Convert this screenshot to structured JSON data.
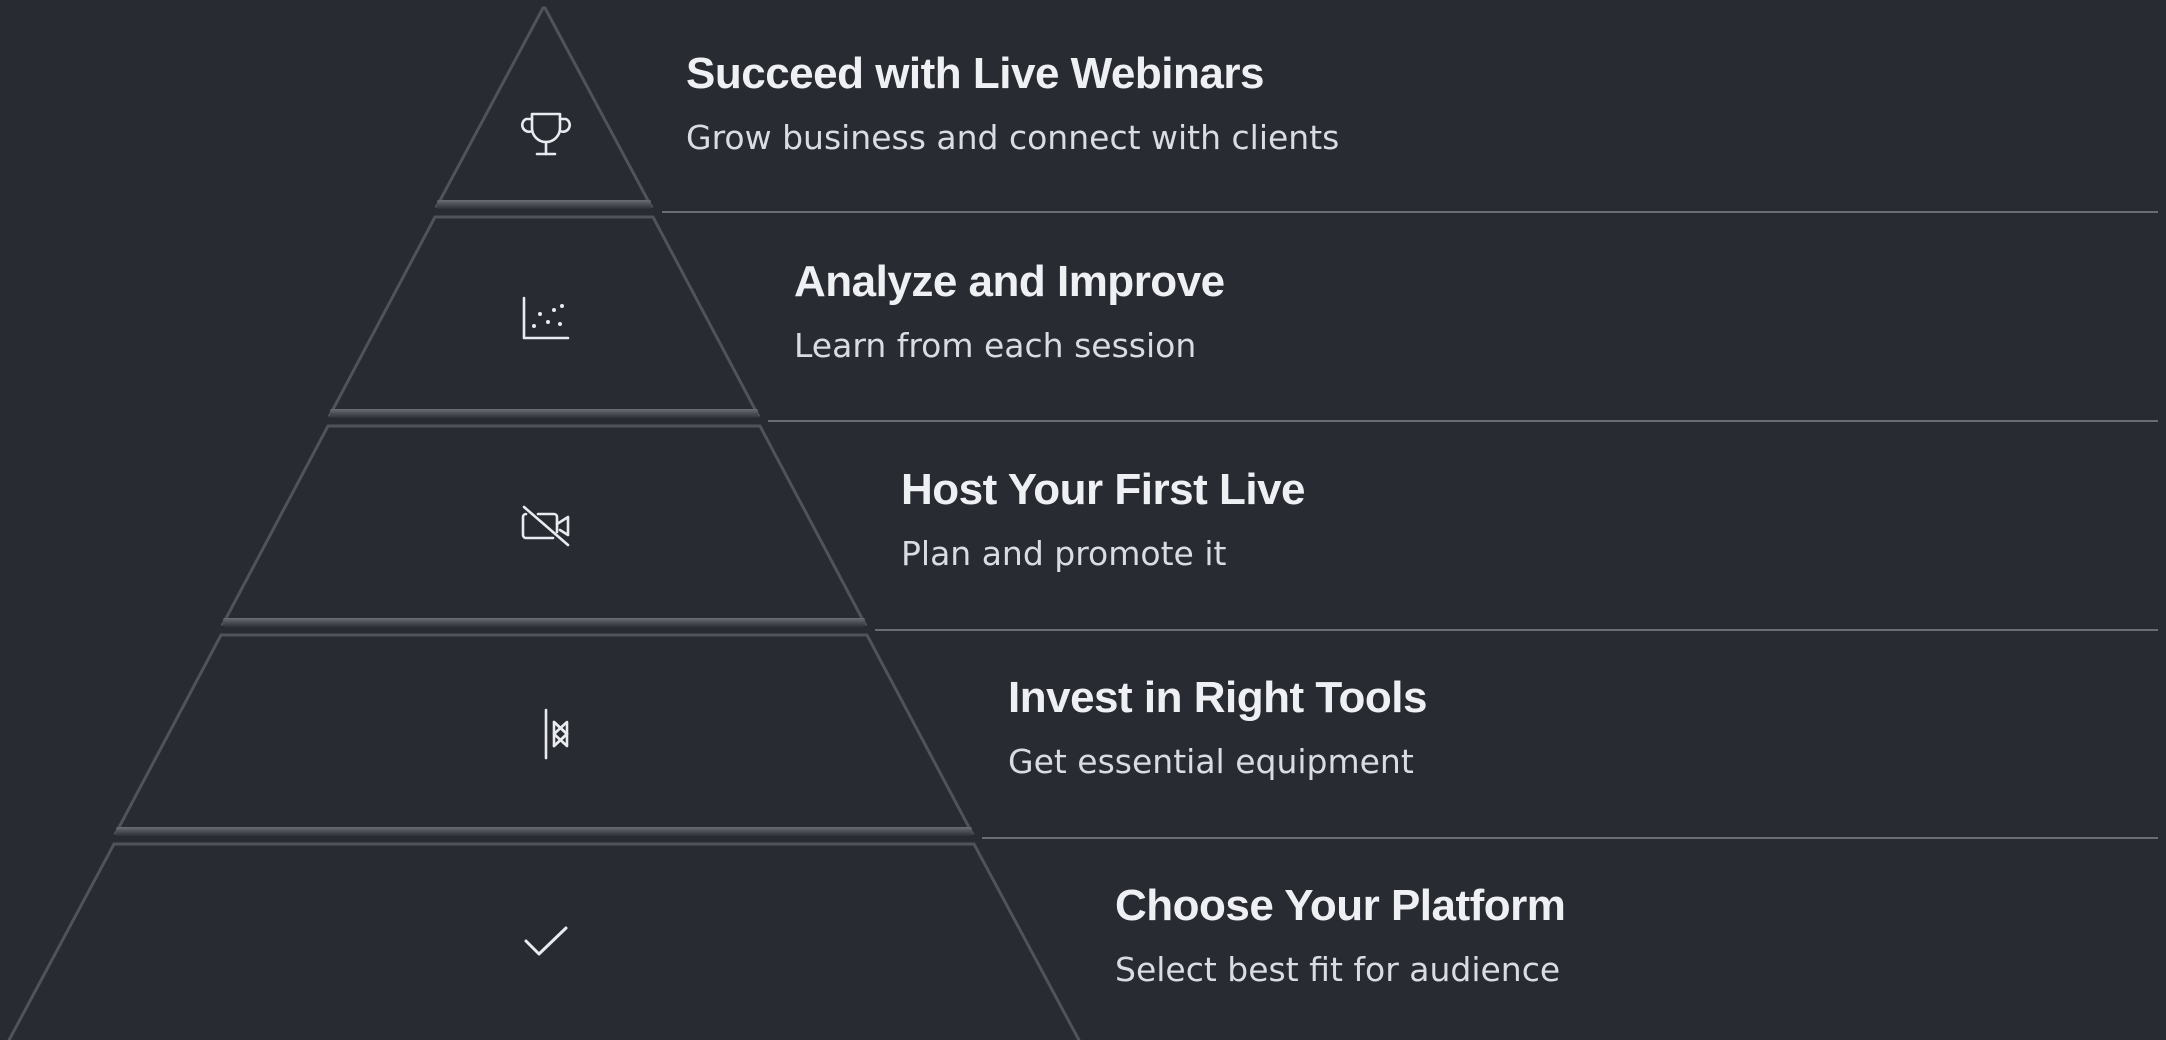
{
  "colors": {
    "background": "#282b32",
    "segment_fill": "#282b32",
    "segment_edge": "#5a5d64",
    "divider": "#6a6d74",
    "icon": "#e9ebef",
    "title": "#eef0f4",
    "subtitle": "#d9dce3"
  },
  "levels": [
    {
      "title": "Succeed with Live Webinars",
      "subtitle": "Grow business and connect with clients",
      "icon": "trophy-icon"
    },
    {
      "title": "Analyze and Improve",
      "subtitle": "Learn from each session",
      "icon": "scatter-chart-icon"
    },
    {
      "title": "Host Your First Live",
      "subtitle": "Plan and promote it",
      "icon": "video-off-icon"
    },
    {
      "title": "Invest in Right Tools",
      "subtitle": "Get essential equipment",
      "icon": "flip-horizontal-icon"
    },
    {
      "title": "Choose Your Platform",
      "subtitle": "Select best fit for audience",
      "icon": "check-icon"
    }
  ]
}
